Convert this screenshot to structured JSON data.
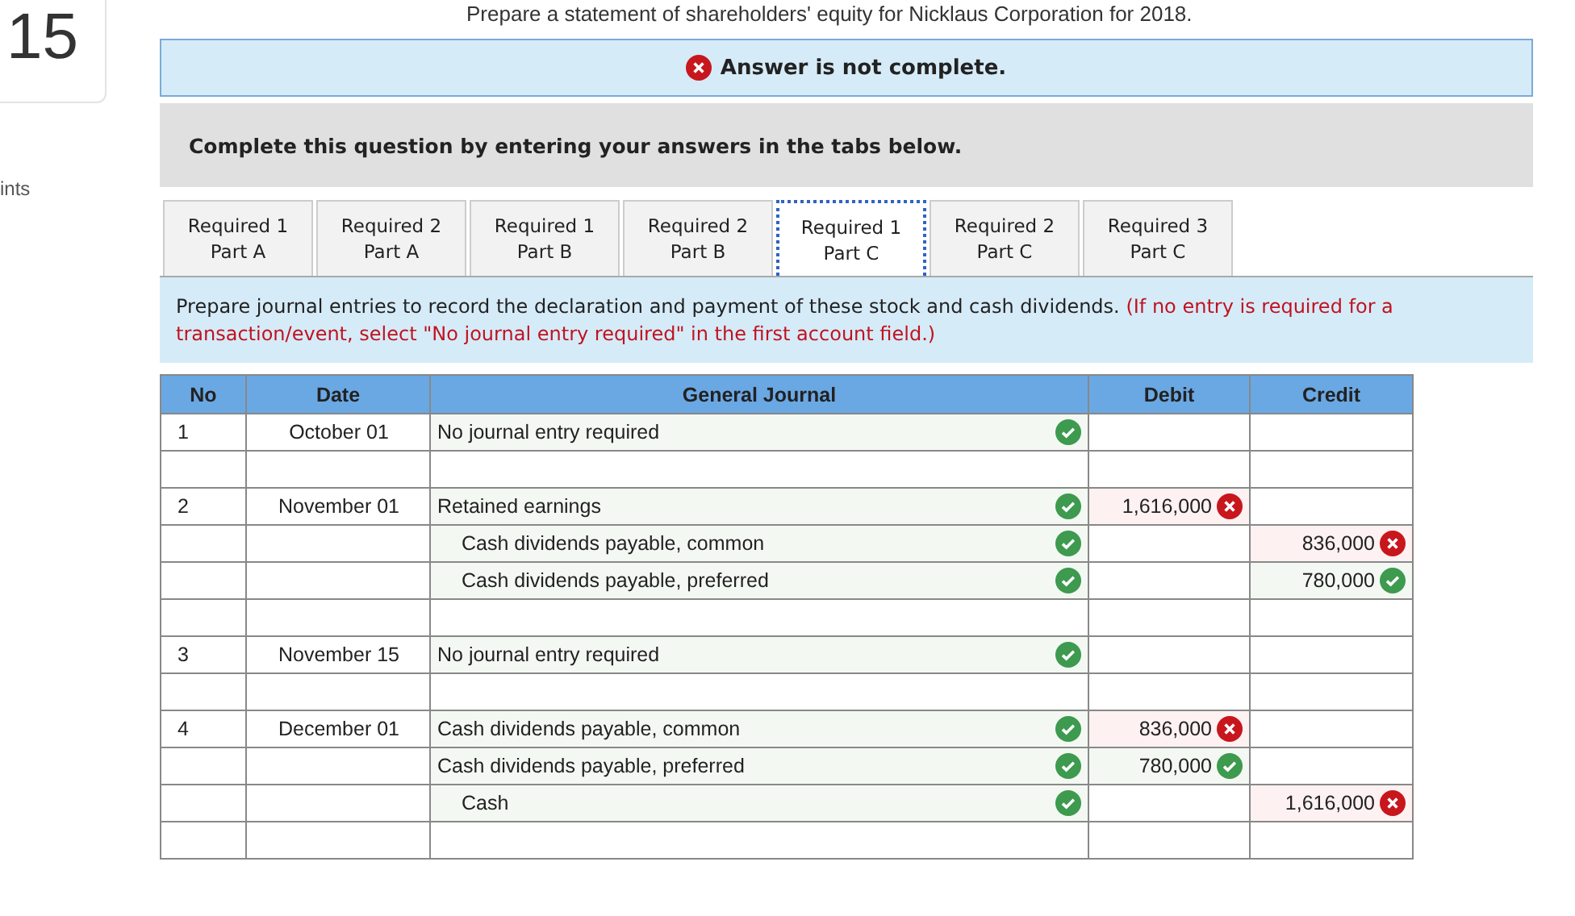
{
  "question": {
    "number": "15",
    "points_label": "ints",
    "prompt": "Prepare a statement of shareholders' equity for Nicklaus Corporation for 2018."
  },
  "alert": {
    "complete": false,
    "text": "Answer is not complete."
  },
  "instructions": "Complete this question by entering your answers in the tabs below.",
  "tabs": [
    {
      "line1": "Required 1",
      "line2": "Part A",
      "selected": false
    },
    {
      "line1": "Required 2",
      "line2": "Part A",
      "selected": false
    },
    {
      "line1": "Required 1",
      "line2": "Part B",
      "selected": false
    },
    {
      "line1": "Required 2",
      "line2": "Part B",
      "selected": false
    },
    {
      "line1": "Required 1",
      "line2": "Part C",
      "selected": true
    },
    {
      "line1": "Required 2",
      "line2": "Part C",
      "selected": false
    },
    {
      "line1": "Required 3",
      "line2": "Part C",
      "selected": false
    }
  ],
  "task": {
    "text": "Prepare journal entries to record the declaration and payment of these stock and cash dividends.",
    "note": "(If no entry is required for a transaction/event, select \"No journal entry required\" in the first account field.)"
  },
  "table": {
    "columns": [
      "No",
      "Date",
      "General Journal",
      "Debit",
      "Credit"
    ],
    "rows": [
      {
        "no": "1",
        "date": "October 01",
        "account": "No journal entry required",
        "indented": false,
        "account_correct": true
      },
      {},
      {
        "no": "2",
        "date": "November 01",
        "account": "Retained earnings",
        "indented": false,
        "account_correct": true,
        "debit": "1,616,000",
        "debit_correct": false
      },
      {
        "account": "Cash dividends payable, common",
        "indented": true,
        "account_correct": true,
        "credit": "836,000",
        "credit_correct": false
      },
      {
        "account": "Cash dividends payable, preferred",
        "indented": true,
        "account_correct": true,
        "credit": "780,000",
        "credit_correct": true
      },
      {},
      {
        "no": "3",
        "date": "November 15",
        "account": "No journal entry required",
        "indented": false,
        "account_correct": true
      },
      {},
      {
        "no": "4",
        "date": "December 01",
        "account": "Cash dividends payable, common",
        "indented": false,
        "account_correct": true,
        "debit": "836,000",
        "debit_correct": false
      },
      {
        "account": "Cash dividends payable, preferred",
        "indented": false,
        "account_correct": true,
        "debit": "780,000",
        "debit_correct": true
      },
      {
        "account": "Cash",
        "indented": true,
        "account_correct": true,
        "credit": "1,616,000",
        "credit_correct": false
      },
      {}
    ]
  }
}
